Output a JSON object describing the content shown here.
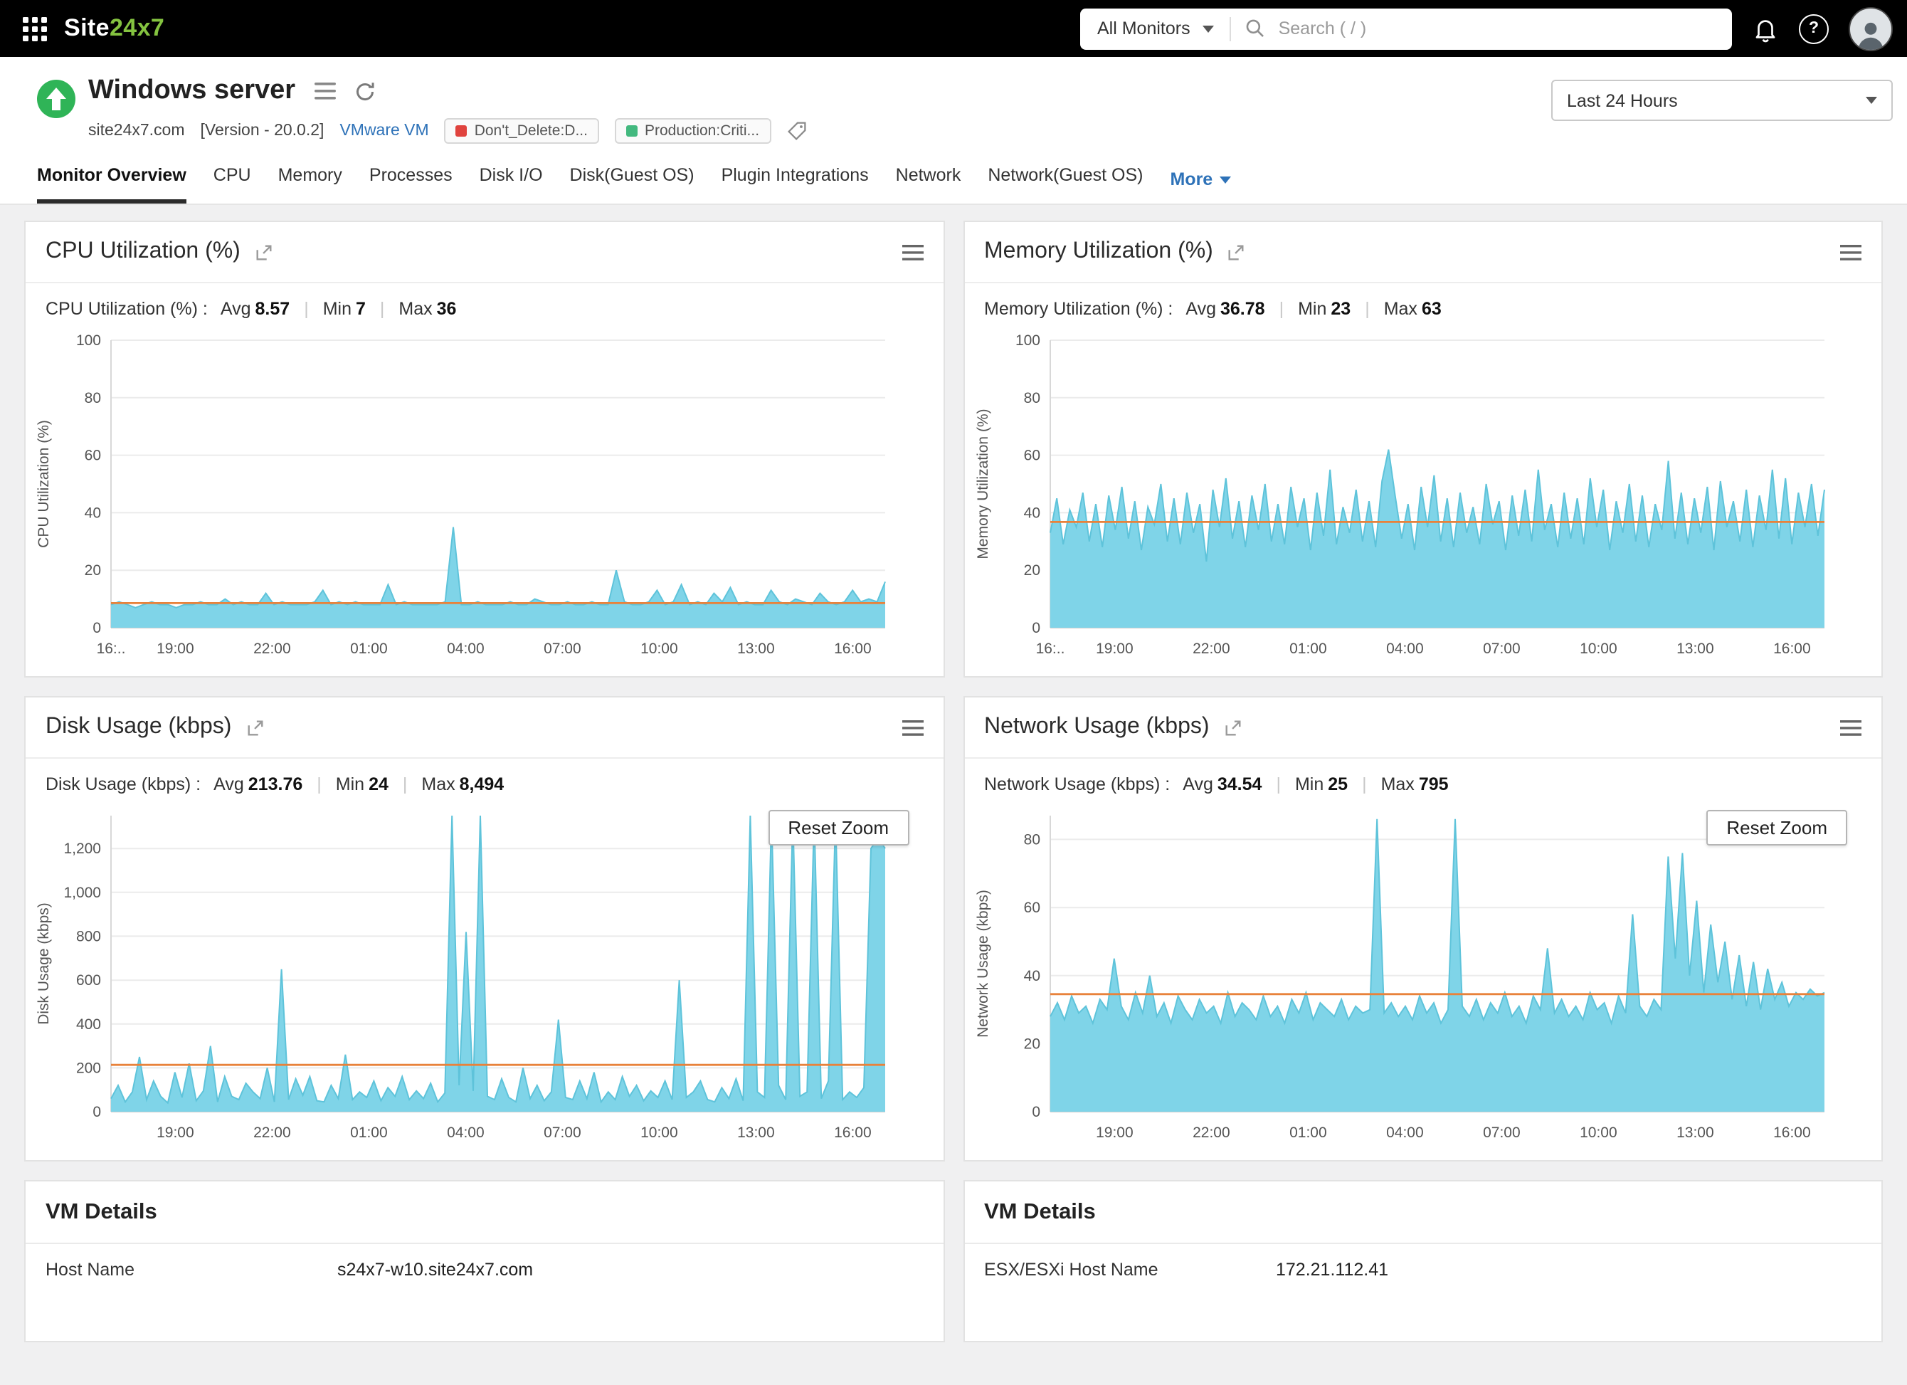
{
  "topbar": {
    "logo": {
      "part1": "Site",
      "part2": "24x7"
    },
    "monitor_scope": "All Monitors",
    "search_placeholder": "Search ( / )"
  },
  "header": {
    "title": "Windows server",
    "host": "site24x7.com",
    "version": "[Version - 20.0.2]",
    "vm_type_link": "VMware VM",
    "tags": [
      {
        "label": "Don't_Delete:D...",
        "color": "#e0433e"
      },
      {
        "label": "Production:Criti...",
        "color": "#43b97f"
      }
    ],
    "time_range": "Last 24 Hours"
  },
  "tabs": {
    "items": [
      "Monitor Overview",
      "CPU",
      "Memory",
      "Processes",
      "Disk I/O",
      "Disk(Guest OS)",
      "Plugin Integrations",
      "Network",
      "Network(Guest OS)"
    ],
    "active": "Monitor Overview",
    "more": "More"
  },
  "panels": [
    {
      "title": "CPU Utilization (%)",
      "stats_label": "CPU Utilization (%) :",
      "avg_label": "Avg",
      "avg": "8.57",
      "min_label": "Min",
      "min": "7",
      "max_label": "Max",
      "max": "36"
    },
    {
      "title": "Memory Utilization (%)",
      "stats_label": "Memory Utilization (%) :",
      "avg_label": "Avg",
      "avg": "36.78",
      "min_label": "Min",
      "min": "23",
      "max_label": "Max",
      "max": "63"
    },
    {
      "title": "Disk Usage (kbps)",
      "stats_label": "Disk Usage (kbps) :",
      "avg_label": "Avg",
      "avg": "213.76",
      "min_label": "Min",
      "min": "24",
      "max_label": "Max",
      "max": "8,494",
      "reset_zoom": "Reset Zoom"
    },
    {
      "title": "Network Usage (kbps)",
      "stats_label": "Network Usage (kbps) :",
      "avg_label": "Avg",
      "avg": "34.54",
      "min_label": "Min",
      "min": "25",
      "max_label": "Max",
      "max": "795",
      "reset_zoom": "Reset Zoom"
    }
  ],
  "chart_data": [
    {
      "type": "area",
      "title": "CPU Utilization (%)",
      "ylabel": "CPU Utilization (%)",
      "ymax": 100,
      "avg": 8.57,
      "y_ticks": [
        {
          "label": "0",
          "v": 0
        },
        {
          "label": "20",
          "v": 20
        },
        {
          "label": "40",
          "v": 40
        },
        {
          "label": "60",
          "v": 60
        },
        {
          "label": "80",
          "v": 80
        },
        {
          "label": "100",
          "v": 100
        }
      ],
      "x_ticks": [
        {
          "label": "16:..",
          "f": 0
        },
        {
          "label": "19:00",
          "f": 0.083
        },
        {
          "label": "22:00",
          "f": 0.208
        },
        {
          "label": "01:00",
          "f": 0.333
        },
        {
          "label": "04:00",
          "f": 0.458
        },
        {
          "label": "07:00",
          "f": 0.583
        },
        {
          "label": "10:00",
          "f": 0.708
        },
        {
          "label": "13:00",
          "f": 0.833
        },
        {
          "label": "16:00",
          "f": 0.958
        }
      ],
      "values": [
        8,
        9,
        8,
        7,
        8,
        9,
        8,
        8,
        7,
        8,
        8,
        9,
        8,
        8,
        10,
        8,
        9,
        8,
        8,
        12,
        8,
        9,
        8,
        8,
        8,
        9,
        13,
        8,
        9,
        8,
        9,
        8,
        8,
        8,
        15,
        8,
        9,
        8,
        8,
        8,
        8,
        9,
        35,
        8,
        8,
        9,
        8,
        8,
        8,
        9,
        8,
        8,
        10,
        9,
        8,
        8,
        9,
        8,
        8,
        9,
        8,
        8,
        20,
        9,
        8,
        8,
        9,
        13,
        8,
        9,
        15,
        8,
        9,
        8,
        12,
        9,
        14,
        8,
        9,
        8,
        8,
        13,
        9,
        8,
        10,
        9,
        8,
        12,
        9,
        8,
        9,
        13,
        9,
        10,
        9,
        16
      ]
    },
    {
      "type": "area",
      "title": "Memory Utilization (%)",
      "ylabel": "Memory Utilization (%)",
      "ymax": 100,
      "avg": 36.78,
      "y_ticks": [
        {
          "label": "0",
          "v": 0
        },
        {
          "label": "20",
          "v": 20
        },
        {
          "label": "40",
          "v": 40
        },
        {
          "label": "60",
          "v": 60
        },
        {
          "label": "80",
          "v": 80
        },
        {
          "label": "100",
          "v": 100
        }
      ],
      "x_ticks": [
        {
          "label": "16:..",
          "f": 0
        },
        {
          "label": "19:00",
          "f": 0.083
        },
        {
          "label": "22:00",
          "f": 0.208
        },
        {
          "label": "01:00",
          "f": 0.333
        },
        {
          "label": "04:00",
          "f": 0.458
        },
        {
          "label": "07:00",
          "f": 0.583
        },
        {
          "label": "10:00",
          "f": 0.708
        },
        {
          "label": "13:00",
          "f": 0.833
        },
        {
          "label": "16:00",
          "f": 0.958
        }
      ],
      "values": [
        33,
        45,
        29,
        41,
        35,
        47,
        30,
        43,
        28,
        46,
        34,
        49,
        31,
        44,
        27,
        42,
        36,
        50,
        30,
        45,
        29,
        47,
        33,
        43,
        23,
        48,
        35,
        52,
        31,
        44,
        28,
        46,
        34,
        50,
        30,
        43,
        29,
        49,
        35,
        45,
        27,
        47,
        32,
        55,
        29,
        42,
        33,
        48,
        30,
        44,
        28,
        51,
        62,
        46,
        31,
        43,
        27,
        49,
        35,
        53,
        30,
        45,
        28,
        47,
        33,
        42,
        29,
        50,
        36,
        44,
        27,
        46,
        32,
        48,
        30,
        55,
        34,
        43,
        28,
        47,
        31,
        45,
        29,
        52,
        35,
        48,
        27,
        44,
        33,
        50,
        30,
        46,
        28,
        43,
        34,
        58,
        31,
        47,
        29,
        45,
        33,
        49,
        27,
        51,
        35,
        44,
        30,
        48,
        28,
        46,
        34,
        55,
        31,
        52,
        29,
        47,
        35,
        50,
        32,
        48
      ]
    },
    {
      "type": "area",
      "title": "Disk Usage (kbps)",
      "ylabel": "Disk Usage (kbps)",
      "ymax": 1350,
      "avg": 213.76,
      "y_ticks": [
        {
          "label": "0",
          "v": 0
        },
        {
          "label": "200",
          "v": 200
        },
        {
          "label": "400",
          "v": 400
        },
        {
          "label": "600",
          "v": 600
        },
        {
          "label": "800",
          "v": 800
        },
        {
          "label": "1,000",
          "v": 1000
        },
        {
          "label": "1,200",
          "v": 1200
        }
      ],
      "x_ticks": [
        {
          "label": "19:00",
          "f": 0.083
        },
        {
          "label": "22:00",
          "f": 0.208
        },
        {
          "label": "01:00",
          "f": 0.333
        },
        {
          "label": "04:00",
          "f": 0.458
        },
        {
          "label": "07:00",
          "f": 0.583
        },
        {
          "label": "10:00",
          "f": 0.708
        },
        {
          "label": "13:00",
          "f": 0.833
        },
        {
          "label": "16:00",
          "f": 0.958
        }
      ],
      "values": [
        60,
        120,
        45,
        90,
        250,
        55,
        140,
        70,
        40,
        180,
        65,
        220,
        50,
        95,
        300,
        45,
        160,
        70,
        55,
        130,
        90,
        60,
        200,
        45,
        650,
        55,
        150,
        75,
        160,
        50,
        45,
        120,
        60,
        260,
        55,
        90,
        65,
        140,
        50,
        110,
        70,
        160,
        55,
        95,
        60,
        130,
        45,
        85,
        1350,
        120,
        820,
        95,
        1350,
        70,
        55,
        150,
        65,
        45,
        200,
        60,
        120,
        50,
        90,
        420,
        65,
        55,
        140,
        60,
        180,
        45,
        90,
        55,
        160,
        70,
        120,
        50,
        95,
        65,
        140,
        55,
        600,
        65,
        90,
        140,
        55,
        45,
        110,
        60,
        150,
        50,
        1350,
        90,
        65,
        1350,
        120,
        55,
        1350,
        70,
        90,
        1350,
        60,
        140,
        1350,
        55,
        90,
        65,
        110,
        1200,
        1250,
        1200
      ]
    },
    {
      "type": "area",
      "title": "Network Usage (kbps)",
      "ylabel": "Network Usage (kbps)",
      "ymax": 87,
      "avg": 34.54,
      "y_ticks": [
        {
          "label": "0",
          "v": 0
        },
        {
          "label": "20",
          "v": 20
        },
        {
          "label": "40",
          "v": 40
        },
        {
          "label": "60",
          "v": 60
        },
        {
          "label": "80",
          "v": 80
        }
      ],
      "x_ticks": [
        {
          "label": "19:00",
          "f": 0.083
        },
        {
          "label": "22:00",
          "f": 0.208
        },
        {
          "label": "01:00",
          "f": 0.333
        },
        {
          "label": "04:00",
          "f": 0.458
        },
        {
          "label": "07:00",
          "f": 0.583
        },
        {
          "label": "10:00",
          "f": 0.708
        },
        {
          "label": "13:00",
          "f": 0.833
        },
        {
          "label": "16:00",
          "f": 0.958
        }
      ],
      "values": [
        28,
        32,
        27,
        34,
        29,
        31,
        26,
        33,
        30,
        45,
        31,
        27,
        35,
        29,
        40,
        28,
        32,
        26,
        34,
        30,
        27,
        33,
        29,
        31,
        26,
        35,
        28,
        32,
        30,
        27,
        34,
        28,
        31,
        26,
        33,
        29,
        35,
        27,
        32,
        30,
        28,
        33,
        27,
        31,
        29,
        30,
        86,
        29,
        32,
        28,
        31,
        27,
        34,
        29,
        32,
        26,
        30,
        86,
        31,
        28,
        33,
        27,
        32,
        29,
        35,
        28,
        31,
        26,
        34,
        30,
        48,
        29,
        33,
        28,
        31,
        27,
        35,
        30,
        32,
        26,
        34,
        29,
        58,
        31,
        28,
        33,
        30,
        75,
        45,
        76,
        40,
        62,
        35,
        55,
        38,
        50,
        33,
        46,
        31,
        44,
        30,
        42,
        33,
        38,
        31,
        35,
        33,
        36,
        34,
        35
      ]
    }
  ],
  "vm_details": [
    {
      "title": "VM Details",
      "rows": [
        {
          "label": "Host Name",
          "value": "s24x7-w10.site24x7.com"
        }
      ]
    },
    {
      "title": "VM Details",
      "rows": [
        {
          "label": "ESX/ESXi Host Name",
          "value": "172.21.112.41"
        }
      ]
    }
  ],
  "colors": {
    "series_fill": "#7fd4e8",
    "series_stroke": "#5ec3da",
    "avg_line": "#e8823b",
    "brand_green": "#84c340",
    "status_green": "#2fb457",
    "link_blue": "#2e72b8"
  }
}
